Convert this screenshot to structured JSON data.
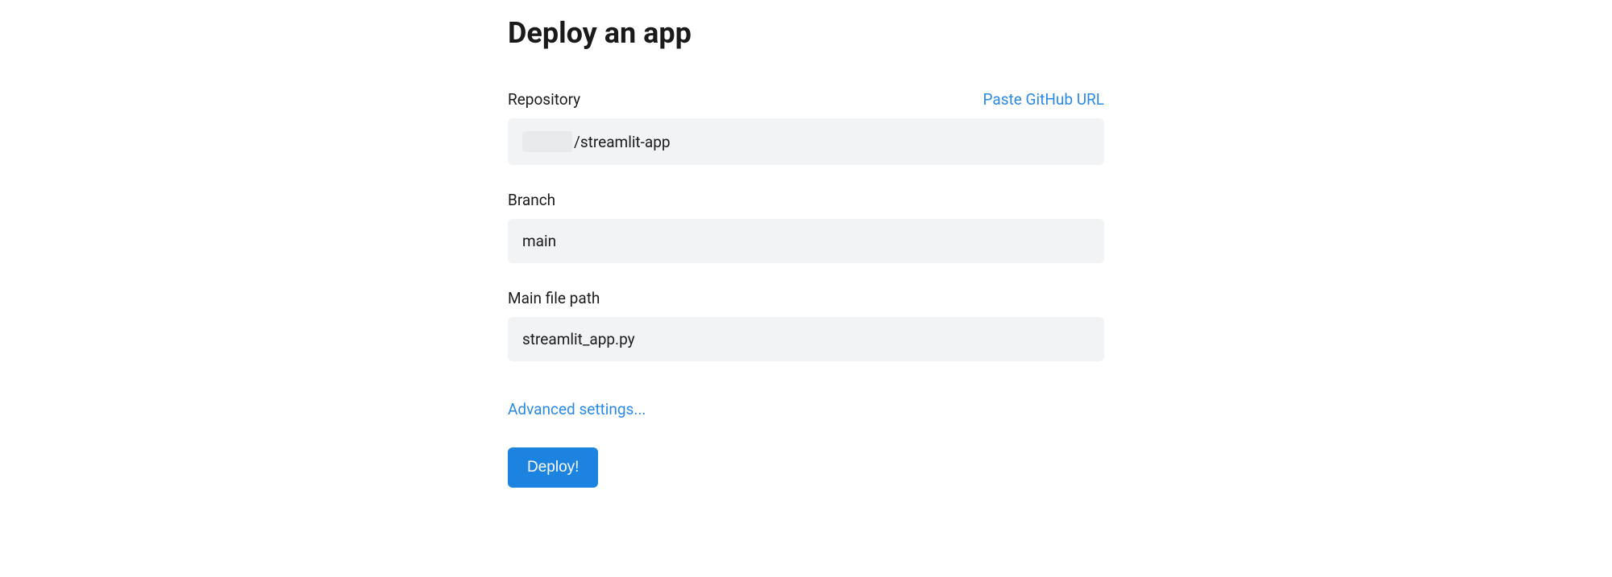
{
  "page": {
    "title": "Deploy an app"
  },
  "form": {
    "repository": {
      "label": "Repository",
      "paste_link": "Paste GitHub URL",
      "value_suffix": "/streamlit-app"
    },
    "branch": {
      "label": "Branch",
      "value": "main"
    },
    "main_file": {
      "label": "Main file path",
      "value": "streamlit_app.py"
    },
    "advanced_link": "Advanced settings...",
    "deploy_button": "Deploy!"
  }
}
